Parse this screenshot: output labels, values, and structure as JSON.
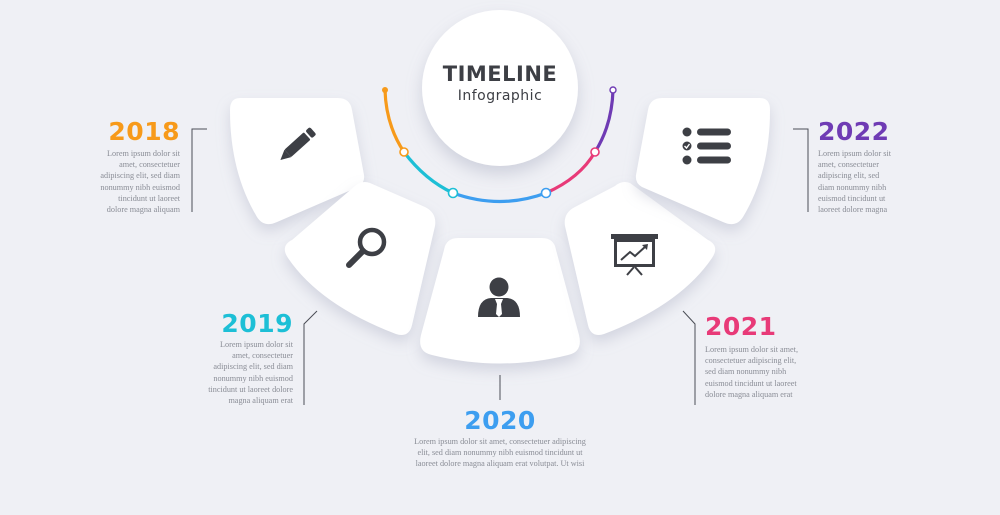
{
  "title": {
    "main": "TIMELINE",
    "sub": "Infographic"
  },
  "milestones": [
    {
      "year": "2018",
      "color": "#f79a1a",
      "icon": "pencil-icon",
      "desc": [
        "Lorem ipsum dolor sit",
        "amet, consectetuer",
        "adipiscing elit, sed diam",
        "nonummy nibh euismod",
        "tincidunt ut laoreet",
        "dolore magna aliquam"
      ]
    },
    {
      "year": "2019",
      "color": "#1dbfd6",
      "icon": "search-icon",
      "desc": [
        "Lorem ipsum dolor sit",
        "amet, consectetuer",
        "adipiscing elit, sed diam",
        "nonummy nibh euismod",
        "tincidunt ut laoreet dolore",
        "magna aliquam erat"
      ]
    },
    {
      "year": "2020",
      "color": "#3d9ef0",
      "icon": "user-icon",
      "desc": [
        "Lorem ipsum dolor sit amet, consectetuer adipiscing",
        "elit, sed diam nonummy nibh euismod tincidunt ut",
        "laoreet dolore magna aliquam erat volutpat. Ut wisi"
      ]
    },
    {
      "year": "2021",
      "color": "#e83a78",
      "icon": "presentation-chart-icon",
      "desc": [
        "Lorem ipsum dolor sit amet,",
        "consectetuer adipiscing elit,",
        "sed diam nonummy nibh",
        "euismod tincidunt ut laoreet",
        "dolore magna aliquam erat"
      ]
    },
    {
      "year": "2022",
      "color": "#6f3bb4",
      "icon": "checklist-icon",
      "desc": [
        "Lorem ipsum dolor sit",
        "amet, consectetuer",
        "adipiscing elit, sed",
        "diam nonummy nibh",
        "euismod tincidunt ut",
        "laoreet dolore magna"
      ]
    }
  ]
}
